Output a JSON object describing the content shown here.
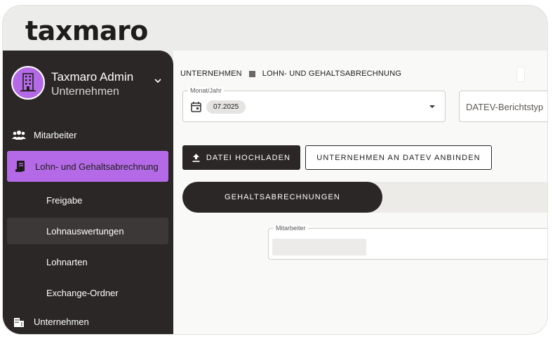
{
  "brand": {
    "logo": "taxmaro"
  },
  "profile": {
    "name": "Taxmaro Admin",
    "subtitle": "Unternehmen"
  },
  "sidebar": {
    "items": [
      {
        "label": "Mitarbeiter",
        "icon": "people-icon"
      },
      {
        "label": "Lohn- und Gehaltsabrechnung",
        "icon": "document-icon",
        "active": true
      },
      {
        "label": "Freigabe"
      },
      {
        "label": "Lohnauswertungen",
        "highlight": true
      },
      {
        "label": "Lohnarten"
      },
      {
        "label": "Exchange-Ordner"
      },
      {
        "label": "Unternehmen",
        "icon": "building-icon"
      }
    ]
  },
  "breadcrumb": {
    "part1": "UNTERNEHMEN",
    "part2": "LOHN- UND GEHALTSABRECHNUNG"
  },
  "filters": {
    "month_label": "Monat/Jahr",
    "month_value": "07.2025",
    "report_placeholder": "DATEV-Berichtstyp"
  },
  "actions": {
    "upload_label": "DATEI HOCHLADEN",
    "connect_label": "UNTERNEHMEN AN DATEV ANBINDEN"
  },
  "tabs": {
    "active_label": "GEHALTSABRECHNUNGEN"
  },
  "employee_filter": {
    "label": "Mitarbeiter"
  },
  "colors": {
    "accent": "#b46ae6",
    "dark": "#2a2726",
    "background": "#f9f9f8"
  }
}
